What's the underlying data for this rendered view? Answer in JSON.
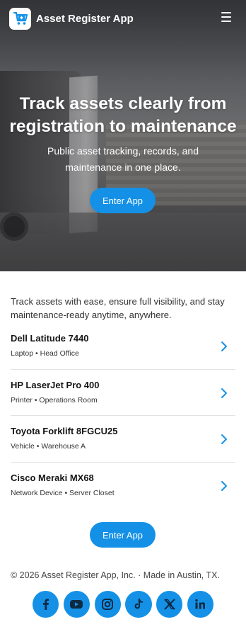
{
  "app": {
    "name": "Asset Register App"
  },
  "hero": {
    "title": "Track assets clearly from registration to maintenance",
    "subtitle": "Public asset tracking, records, and maintenance in one place.",
    "cta_label": "Enter App"
  },
  "main": {
    "intro": "Track assets with ease, ensure full visibility, and stay maintenance-ready anytime, anywhere.",
    "assets": [
      {
        "name": "Dell Latitude 7440",
        "meta": "Laptop • Head Office"
      },
      {
        "name": "HP LaserJet Pro 400",
        "meta": "Printer • Operations Room"
      },
      {
        "name": "Toyota Forklift 8FGCU25",
        "meta": "Vehicle • Warehouse A"
      },
      {
        "name": "Cisco Meraki MX68",
        "meta": "Network Device • Server Closet"
      }
    ],
    "cta_label": "Enter App"
  },
  "footer": {
    "copyright": "© 2026 Asset Register App, Inc. · Made in Austin, TX.",
    "social_icons": [
      "facebook-icon",
      "youtube-icon",
      "instagram-icon",
      "tiktok-icon",
      "x-icon",
      "linkedin-icon"
    ]
  },
  "colors": {
    "accent": "#1491e6",
    "divider": "#e2e2e2",
    "text": "#151515"
  }
}
